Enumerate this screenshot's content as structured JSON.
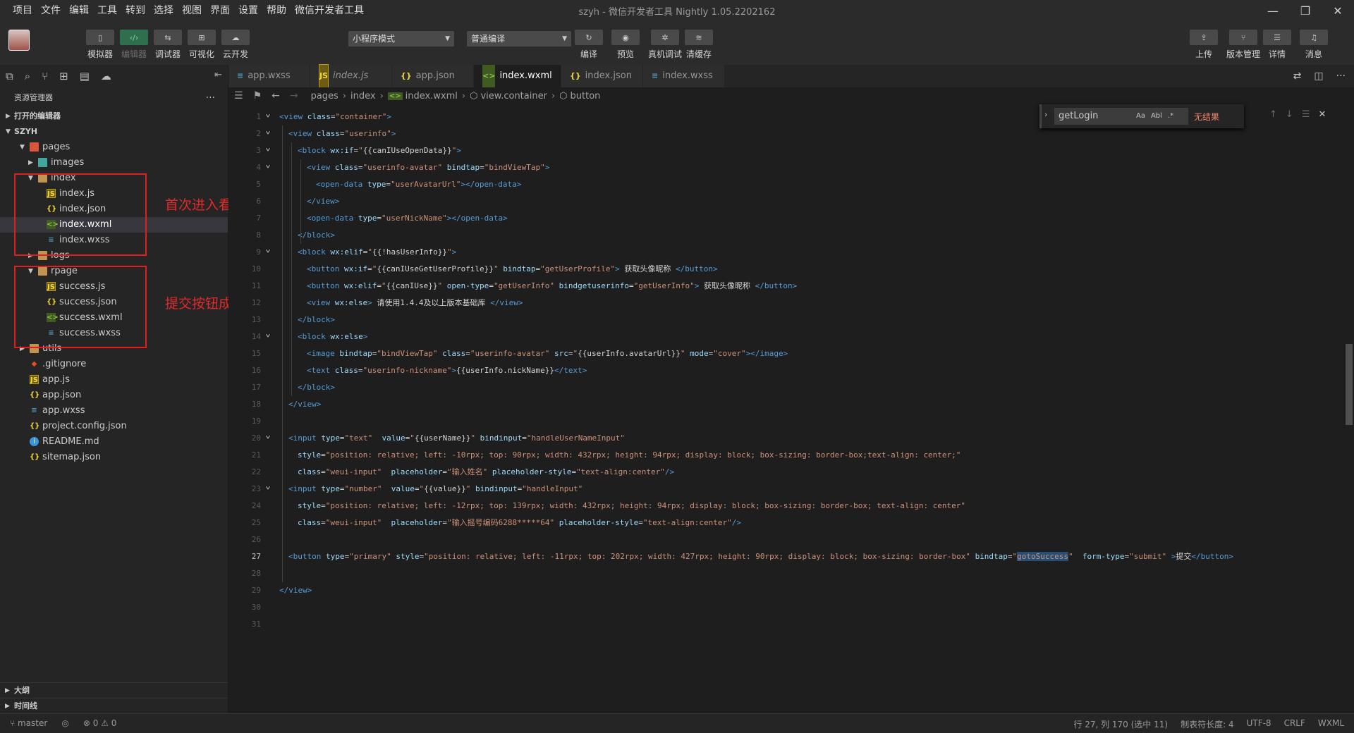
{
  "menubar": {
    "items": [
      "项目",
      "文件",
      "编辑",
      "工具",
      "转到",
      "选择",
      "视图",
      "界面",
      "设置",
      "帮助",
      "微信开发者工具"
    ],
    "window_title": "szyh - 微信开发者工具 Nightly 1.05.2202162"
  },
  "toolbar": {
    "left_buttons": [
      {
        "label": "模拟器",
        "icon": "phone-icon",
        "glyph": "▯"
      },
      {
        "label": "编辑器",
        "icon": "code-icon",
        "glyph": "‹/›"
      },
      {
        "label": "调试器",
        "icon": "debug-icon",
        "glyph": "⇆"
      },
      {
        "label": "可视化",
        "icon": "layout-icon",
        "glyph": "⊞"
      },
      {
        "label": "云开发",
        "icon": "cloud-icon",
        "glyph": "☁"
      }
    ],
    "mode_select": "小程序模式",
    "compile_select": "普通编译",
    "mid_buttons": [
      {
        "label": "编译",
        "icon": "refresh-icon",
        "glyph": "↻"
      },
      {
        "label": "预览",
        "icon": "eye-icon",
        "glyph": "◉"
      },
      {
        "label": "真机调试",
        "icon": "bug-icon",
        "glyph": "✲"
      },
      {
        "label": "清缓存",
        "icon": "layers-icon",
        "glyph": "≋"
      }
    ],
    "right_buttons": [
      {
        "label": "上传",
        "icon": "upload-icon",
        "glyph": "⇪"
      },
      {
        "label": "版本管理",
        "icon": "branch-icon",
        "glyph": "⑂"
      },
      {
        "label": "详情",
        "icon": "menu-icon",
        "glyph": "☰"
      },
      {
        "label": "消息",
        "icon": "bell-icon",
        "glyph": "♫"
      }
    ]
  },
  "sidebar": {
    "title": "资源管理器",
    "open_editors": "打开的编辑器",
    "project": "SZYH",
    "tree": [
      {
        "name": "pages",
        "depth": 1,
        "type": "folder-red",
        "expanded": true
      },
      {
        "name": "images",
        "depth": 2,
        "type": "folder-teal",
        "expanded": false
      },
      {
        "name": "index",
        "depth": 2,
        "type": "folder",
        "expanded": true
      },
      {
        "name": "index.js",
        "depth": 3,
        "type": "js"
      },
      {
        "name": "index.json",
        "depth": 3,
        "type": "json"
      },
      {
        "name": "index.wxml",
        "depth": 3,
        "type": "wxml",
        "selected": true
      },
      {
        "name": "index.wxss",
        "depth": 3,
        "type": "wxss"
      },
      {
        "name": "logs",
        "depth": 2,
        "type": "folder",
        "expanded": false
      },
      {
        "name": "rpage",
        "depth": 2,
        "type": "folder",
        "expanded": true
      },
      {
        "name": "success.js",
        "depth": 3,
        "type": "js"
      },
      {
        "name": "success.json",
        "depth": 3,
        "type": "json"
      },
      {
        "name": "success.wxml",
        "depth": 3,
        "type": "wxml"
      },
      {
        "name": "success.wxss",
        "depth": 3,
        "type": "wxss"
      },
      {
        "name": "utils",
        "depth": 1,
        "type": "folder",
        "expanded": false
      },
      {
        "name": ".gitignore",
        "depth": 1,
        "type": "git"
      },
      {
        "name": "app.js",
        "depth": 1,
        "type": "js"
      },
      {
        "name": "app.json",
        "depth": 1,
        "type": "json"
      },
      {
        "name": "app.wxss",
        "depth": 1,
        "type": "wxss"
      },
      {
        "name": "project.config.json",
        "depth": 1,
        "type": "json"
      },
      {
        "name": "README.md",
        "depth": 1,
        "type": "info"
      },
      {
        "name": "sitemap.json",
        "depth": 1,
        "type": "json"
      }
    ],
    "annotations": [
      "首次进入看到的页面",
      "提交按钮成功后的页面"
    ],
    "outline": "大纲",
    "timeline": "时间线"
  },
  "tabs": [
    {
      "label": "app.wxss",
      "icon": "wxss",
      "italic": false,
      "active": false
    },
    {
      "label": "index.js",
      "icon": "js",
      "italic": true,
      "active": false
    },
    {
      "label": "app.json",
      "icon": "json",
      "italic": false,
      "active": false
    },
    {
      "label": "index.wxml",
      "icon": "wxml",
      "italic": false,
      "active": true
    },
    {
      "label": "index.json",
      "icon": "json",
      "italic": false,
      "active": false
    },
    {
      "label": "index.wxss",
      "icon": "wxss",
      "italic": false,
      "active": false
    }
  ],
  "breadcrumb": [
    "pages",
    "index",
    "index.wxml",
    "view.container",
    "button"
  ],
  "find": {
    "query": "getLogin",
    "status": "无结果",
    "opts": [
      "Aa",
      "Abl",
      ".*"
    ]
  },
  "editor": {
    "current_line": 27,
    "lines": [
      {
        "n": 1,
        "fold": true,
        "indent": 0,
        "html": "<span class=\"c-tag\">&lt;view</span> <span class=\"c-attr\">class</span>=<span class=\"c-str\">\"container\"</span><span class=\"c-tag\">&gt;</span>"
      },
      {
        "n": 2,
        "fold": true,
        "indent": 1,
        "html": "<span class=\"c-tag\">&lt;view</span> <span class=\"c-attr\">class</span>=<span class=\"c-str\">\"userinfo\"</span><span class=\"c-tag\">&gt;</span>"
      },
      {
        "n": 3,
        "fold": true,
        "indent": 2,
        "html": "<span class=\"c-tag\">&lt;block</span> <span class=\"c-attr\">wx:if</span>=<span class=\"c-str\">\"</span><span class=\"c-text\">{{canIUseOpenData}}</span><span class=\"c-str\">\"</span><span class=\"c-tag\">&gt;</span>"
      },
      {
        "n": 4,
        "fold": true,
        "indent": 3,
        "html": "<span class=\"c-tag\">&lt;view</span> <span class=\"c-attr\">class</span>=<span class=\"c-str\">\"userinfo-avatar\"</span> <span class=\"c-attr\">bindtap</span>=<span class=\"c-str\">\"bindViewTap\"</span><span class=\"c-tag\">&gt;</span>"
      },
      {
        "n": 5,
        "fold": false,
        "indent": 4,
        "html": "<span class=\"c-tag\">&lt;open-data</span> <span class=\"c-attr\">type</span>=<span class=\"c-str\">\"userAvatarUrl\"</span><span class=\"c-tag\">&gt;&lt;/open-data&gt;</span>"
      },
      {
        "n": 6,
        "fold": false,
        "indent": 3,
        "html": "<span class=\"c-tag\">&lt;/view&gt;</span>"
      },
      {
        "n": 7,
        "fold": false,
        "indent": 3,
        "html": "<span class=\"c-tag\">&lt;open-data</span> <span class=\"c-attr\">type</span>=<span class=\"c-str\">\"userNickName\"</span><span class=\"c-tag\">&gt;&lt;/open-data&gt;</span>"
      },
      {
        "n": 8,
        "fold": false,
        "indent": 2,
        "html": "<span class=\"c-tag\">&lt;/block&gt;</span>"
      },
      {
        "n": 9,
        "fold": true,
        "indent": 2,
        "html": "<span class=\"c-tag\">&lt;block</span> <span class=\"c-attr\">wx:elif</span>=<span class=\"c-str\">\"</span><span class=\"c-text\">{{!hasUserInfo}}</span><span class=\"c-str\">\"</span><span class=\"c-tag\">&gt;</span>"
      },
      {
        "n": 10,
        "fold": false,
        "indent": 3,
        "html": "<span class=\"c-tag\">&lt;button</span> <span class=\"c-attr\">wx:if</span>=<span class=\"c-str\">\"</span><span class=\"c-text\">{{canIUseGetUserProfile}}</span><span class=\"c-str\">\"</span> <span class=\"c-attr\">bindtap</span>=<span class=\"c-str\">\"getUserProfile\"</span><span class=\"c-tag\">&gt;</span><span class=\"c-text\"> 获取头像昵称 </span><span class=\"c-tag\">&lt;/button&gt;</span>"
      },
      {
        "n": 11,
        "fold": false,
        "indent": 3,
        "html": "<span class=\"c-tag\">&lt;button</span> <span class=\"c-attr\">wx:elif</span>=<span class=\"c-str\">\"</span><span class=\"c-text\">{{canIUse}}</span><span class=\"c-str\">\"</span> <span class=\"c-attr\">open-type</span>=<span class=\"c-str\">\"getUserInfo\"</span> <span class=\"c-attr\">bindgetuserinfo</span>=<span class=\"c-str\">\"getUserInfo\"</span><span class=\"c-tag\">&gt;</span><span class=\"c-text\"> 获取头像昵称 </span><span class=\"c-tag\">&lt;/button&gt;</span>"
      },
      {
        "n": 12,
        "fold": false,
        "indent": 3,
        "html": "<span class=\"c-tag\">&lt;view</span> <span class=\"c-attr\">wx:else</span><span class=\"c-tag\">&gt;</span><span class=\"c-text\"> 请使用1.4.4及以上版本基础库 </span><span class=\"c-tag\">&lt;/view&gt;</span>"
      },
      {
        "n": 13,
        "fold": false,
        "indent": 2,
        "html": "<span class=\"c-tag\">&lt;/block&gt;</span>"
      },
      {
        "n": 14,
        "fold": true,
        "indent": 2,
        "html": "<span class=\"c-tag\">&lt;block</span> <span class=\"c-attr\">wx:else</span><span class=\"c-tag\">&gt;</span>"
      },
      {
        "n": 15,
        "fold": false,
        "indent": 3,
        "html": "<span class=\"c-tag\">&lt;image</span> <span class=\"c-attr\">bindtap</span>=<span class=\"c-str\">\"bindViewTap\"</span> <span class=\"c-attr\">class</span>=<span class=\"c-str\">\"userinfo-avatar\"</span> <span class=\"c-attr\">src</span>=<span class=\"c-str\">\"</span><span class=\"c-text\">{{userInfo.avatarUrl}}</span><span class=\"c-str\">\"</span> <span class=\"c-attr\">mode</span>=<span class=\"c-str\">\"cover\"</span><span class=\"c-tag\">&gt;&lt;/image&gt;</span>"
      },
      {
        "n": 16,
        "fold": false,
        "indent": 3,
        "html": "<span class=\"c-tag\">&lt;text</span> <span class=\"c-attr\">class</span>=<span class=\"c-str\">\"userinfo-nickname\"</span><span class=\"c-tag\">&gt;</span><span class=\"c-text\">{{userInfo.nickName}}</span><span class=\"c-tag\">&lt;/text&gt;</span>"
      },
      {
        "n": 17,
        "fold": false,
        "indent": 2,
        "html": "<span class=\"c-tag\">&lt;/block&gt;</span>"
      },
      {
        "n": 18,
        "fold": false,
        "indent": 1,
        "html": "<span class=\"c-tag\">&lt;/view&gt;</span>"
      },
      {
        "n": 19,
        "fold": false,
        "indent": 0,
        "html": ""
      },
      {
        "n": 20,
        "fold": true,
        "indent": 1,
        "html": "<span class=\"c-tag\">&lt;input</span> <span class=\"c-attr\">type</span>=<span class=\"c-str\">\"text\"</span>  <span class=\"c-attr\">value</span>=<span class=\"c-str\">\"</span><span class=\"c-text\">{{userName}}</span><span class=\"c-str\">\"</span> <span class=\"c-attr\">bindinput</span>=<span class=\"c-str\">\"handleUserNameInput\"</span>"
      },
      {
        "n": 21,
        "fold": false,
        "indent": 2,
        "html": "<span class=\"c-attr\">style</span>=<span class=\"c-str\">\"position: relative; left: -10rpx; top: 90rpx; width: 432rpx; height: 94rpx; display: block; box-sizing: border-box;text-align: center;\"</span>"
      },
      {
        "n": 22,
        "fold": false,
        "indent": 2,
        "html": "<span class=\"c-attr\">class</span>=<span class=\"c-str\">\"weui-input\"</span>  <span class=\"c-attr\">placeholder</span>=<span class=\"c-str\">\"输入姓名\"</span> <span class=\"c-attr\">placeholder-style</span>=<span class=\"c-str\">\"text-align:center\"</span><span class=\"c-tag\">/&gt;</span>"
      },
      {
        "n": 23,
        "fold": true,
        "indent": 1,
        "html": "<span class=\"c-tag\">&lt;input</span> <span class=\"c-attr\">type</span>=<span class=\"c-str\">\"number\"</span>  <span class=\"c-attr\">value</span>=<span class=\"c-str\">\"</span><span class=\"c-text\">{{value}}</span><span class=\"c-str\">\"</span> <span class=\"c-attr\">bindinput</span>=<span class=\"c-str\">\"handleInput\"</span>"
      },
      {
        "n": 24,
        "fold": false,
        "indent": 2,
        "html": "<span class=\"c-attr\">style</span>=<span class=\"c-str\">\"position: relative; left: -12rpx; top: 139rpx; width: 432rpx; height: 94rpx; display: block; box-sizing: border-box; text-align: center\"</span>"
      },
      {
        "n": 25,
        "fold": false,
        "indent": 2,
        "html": "<span class=\"c-attr\">class</span>=<span class=\"c-str\">\"weui-input\"</span>  <span class=\"c-attr\">placeholder</span>=<span class=\"c-str\">\"输入摇号编码6288*****64\"</span> <span class=\"c-attr\">placeholder-style</span>=<span class=\"c-str\">\"text-align:center\"</span><span class=\"c-tag\">/&gt;</span>"
      },
      {
        "n": 26,
        "fold": false,
        "indent": 0,
        "html": ""
      },
      {
        "n": 27,
        "fold": false,
        "indent": 1,
        "html": "<span class=\"c-tag\">&lt;button</span> <span class=\"c-attr\">type</span>=<span class=\"c-str\">\"primary\"</span> <span class=\"c-attr\">style</span>=<span class=\"c-str\">\"position: relative; left: -11rpx; top: 202rpx; width: 427rpx; height: 90rpx; display: block; box-sizing: border-box\"</span> <span class=\"c-attr\">bindtap</span>=<span class=\"c-str\">\"<span class=\"c-hl\">gotoSuccess</span>\"</span>  <span class=\"c-attr\">form-type</span>=<span class=\"c-str\">\"submit\"</span> <span class=\"c-tag\">&gt;</span><span class=\"c-text\">提交</span><span class=\"c-tag\">&lt;/button&gt;</span>"
      },
      {
        "n": 28,
        "fold": false,
        "indent": 0,
        "html": ""
      },
      {
        "n": 29,
        "fold": false,
        "indent": 0,
        "html": "<span class=\"c-tag\">&lt;/view&gt;</span>"
      },
      {
        "n": 30,
        "fold": false,
        "indent": 0,
        "html": ""
      },
      {
        "n": 31,
        "fold": false,
        "indent": 0,
        "html": ""
      }
    ]
  },
  "statusbar": {
    "branch": "master",
    "problems": "⊗ 0 ⚠ 0",
    "position": "行 27, 列 170 (选中 11)",
    "indent": "制表符长度: 4",
    "encoding": "UTF-8",
    "eol": "CRLF",
    "language": "WXML"
  }
}
